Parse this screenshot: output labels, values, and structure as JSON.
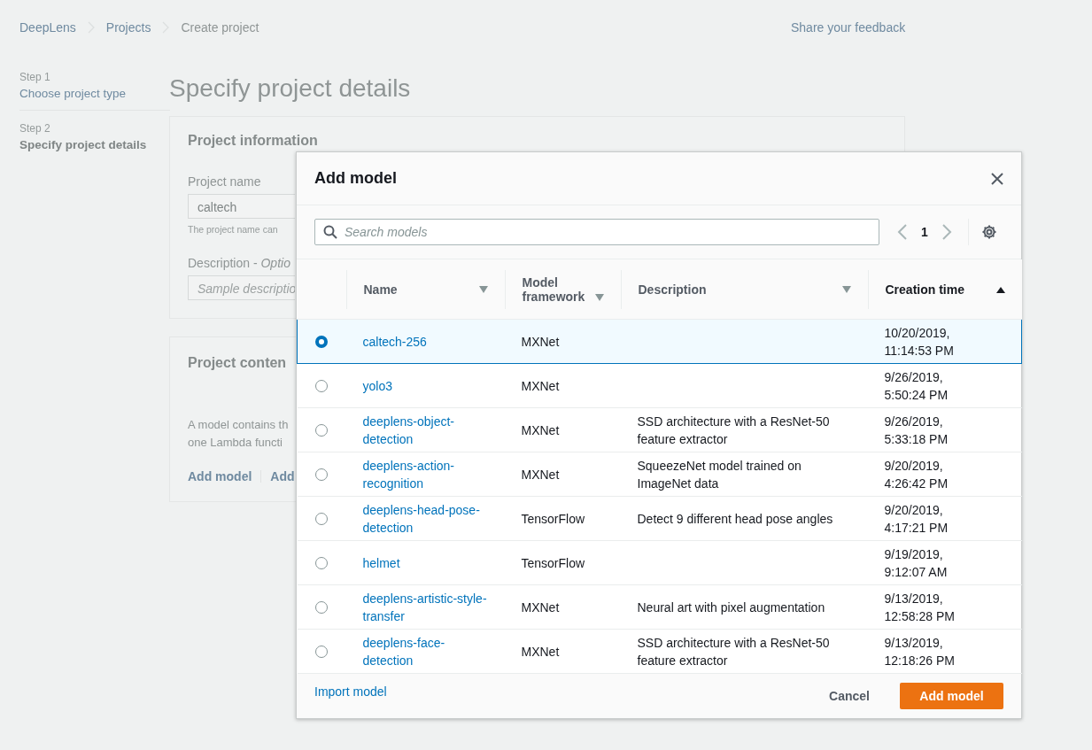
{
  "breadcrumbs": [
    {
      "label": "DeepLens",
      "current": false
    },
    {
      "label": "Projects",
      "current": false
    },
    {
      "label": "Create project",
      "current": true
    }
  ],
  "feedback_link": "Share your feedback",
  "steps": [
    {
      "step": "Step 1",
      "label": "Choose project type",
      "selected": false
    },
    {
      "step": "Step 2",
      "label": "Specify project details",
      "selected": true
    }
  ],
  "page_title": "Specify project details",
  "project_information": {
    "title": "Project information",
    "name_label": "Project name",
    "name_value": "caltech",
    "name_hint": "The project name can",
    "description_label": "Description - *Optio*",
    "description_placeholder": "Sample descriptio"
  },
  "project_content": {
    "title": "Project conten",
    "text_lines": [
      "A model contains th",
      "one Lambda functi"
    ],
    "links": [
      "Add model",
      "Add"
    ]
  },
  "dialog": {
    "title": "Add model",
    "search_placeholder": "Search models",
    "page": "1",
    "columns": [
      {
        "label": "Name",
        "sorted": false
      },
      {
        "label": "Model framework",
        "sorted": false
      },
      {
        "label": "Description",
        "sorted": false
      },
      {
        "label": "Creation time",
        "sorted": true
      }
    ],
    "rows": [
      {
        "name": "caltech-256",
        "framework": "MXNet",
        "created": "10/20/2019, 11:14:53 PM",
        "selected": true
      },
      {
        "name": "yolo3",
        "framework": "MXNet",
        "created": "9/26/2019, 5:50:24 PM",
        "selected": false
      },
      {
        "name": "deeplens-object-detection",
        "framework": "MXNet",
        "description": "SSD architecture with a ResNet-50 feature extractor",
        "created": "9/26/2019, 5:33:18 PM",
        "selected": false
      },
      {
        "name": "deeplens-action-recognition",
        "framework": "MXNet",
        "description": "SqueezeNet model trained on ImageNet data",
        "created": "9/20/2019, 4:26:42 PM",
        "selected": false
      },
      {
        "name": "deeplens-head-pose-detection",
        "framework": "TensorFlow",
        "description": "Detect 9 different head pose angles",
        "created": "9/20/2019, 4:17:21 PM",
        "selected": false
      },
      {
        "name": "helmet",
        "framework": "TensorFlow",
        "created": "9/19/2019, 9:12:07 AM",
        "selected": false
      },
      {
        "name": "deeplens-artistic-style-transfer",
        "framework": "MXNet",
        "description": "Neural art with pixel augmentation",
        "created": "9/13/2019, 12:58:28 PM",
        "selected": false
      },
      {
        "name": "deeplens-face-detection",
        "framework": "MXNet",
        "description": "SSD architecture with a ResNet-50 feature extractor",
        "created": "9/13/2019, 12:18:26 PM",
        "selected": false
      }
    ],
    "import_link": "Import model",
    "cancel_button": "Cancel",
    "confirm_button": "Add model"
  }
}
